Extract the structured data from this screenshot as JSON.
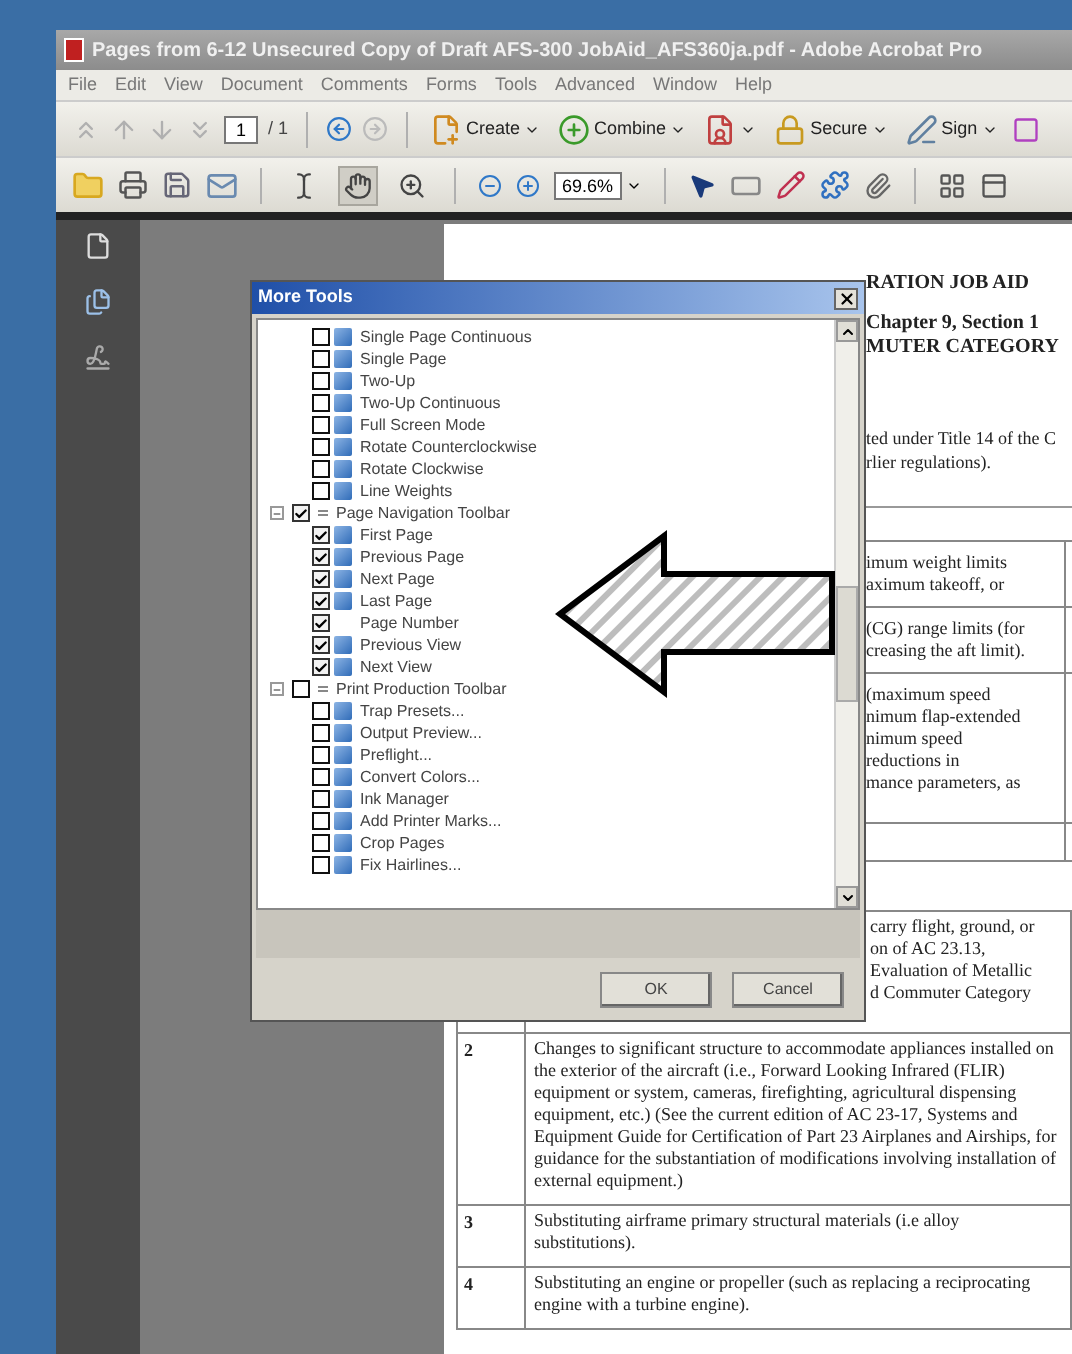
{
  "window": {
    "title": "Pages from 6-12 Unsecured Copy of Draft AFS-300 JobAid_AFS360ja.pdf - Adobe Acrobat Pro"
  },
  "menu": [
    "File",
    "Edit",
    "View",
    "Document",
    "Comments",
    "Forms",
    "Tools",
    "Advanced",
    "Window",
    "Help"
  ],
  "toolbar_1": {
    "page_number": "1",
    "page_count": "/ 1",
    "tasks": [
      {
        "label": "Create",
        "dropdown": true
      },
      {
        "label": "Combine",
        "dropdown": true
      },
      {
        "dropdown": true
      },
      {
        "label": "Secure",
        "dropdown": true
      },
      {
        "label": "Sign",
        "dropdown": true
      }
    ]
  },
  "toolbar_2": {
    "tools": [
      {
        "selected": false
      },
      {
        "selected": true
      },
      {
        "selected": false
      }
    ],
    "zoom": "69.6%"
  },
  "document": {
    "header": [
      "RATION JOB AID",
      "Chapter 9, Section 1",
      "MUTER CATEGORY"
    ],
    "intro": [
      "ted under Title 14 of the C",
      "rlier regulations)."
    ],
    "upper_rows": [
      [
        "imum weight limits",
        "aximum takeoff, or"
      ],
      [
        "(CG) range limits (for",
        "creasing the aft limit)."
      ],
      [
        "(maximum speed",
        "nimum flap-extended",
        "nimum speed",
        "reductions in",
        "mance parameters, as"
      ],
      []
    ],
    "table_rows": [
      {
        "number": "",
        "text": [
          "carry flight, ground, or",
          "on of AC 23.13,",
          "Evaluation of Metallic",
          "d Commuter Category"
        ]
      },
      {
        "number": "2",
        "text": [
          "Changes to significant structure to accommodate appliances installed on the exterior of the aircraft (i.e., Forward Looking Infrared (FLIR) equipment or system, cameras, firefighting, agricultural dispensing equipment, etc.) (See the current edition of AC 23-17, Systems and Equipment Guide for Certification of Part 23 Airplanes and Airships, for guidance for the substantiation of modifications involving installation of external equipment.)"
        ]
      },
      {
        "number": "3",
        "text": [
          "Substituting airframe primary structural materials (i.e alloy substitutions)."
        ]
      },
      {
        "number": "4",
        "text": [
          "Substituting an engine or propeller (such as replacing a reciprocating engine with a turbine engine)."
        ]
      }
    ]
  },
  "dialog": {
    "title": "More Tools",
    "groups": [
      {
        "children": [
          {
            "label": "Single Page Continuous",
            "checked": false,
            "icon": true
          },
          {
            "label": "Single Page",
            "checked": false,
            "icon": true
          },
          {
            "label": "Two-Up",
            "checked": false,
            "icon": true
          },
          {
            "label": "Two-Up Continuous",
            "checked": false,
            "icon": true
          },
          {
            "label": "Full Screen Mode",
            "checked": false,
            "icon": true
          },
          {
            "label": "Rotate Counterclockwise",
            "checked": false,
            "icon": true
          },
          {
            "label": "Rotate Clockwise",
            "checked": false,
            "icon": true
          },
          {
            "label": "Line Weights",
            "checked": false,
            "icon": true
          }
        ]
      },
      {
        "label": "Page Navigation Toolbar",
        "checked": true,
        "expanded": true,
        "children": [
          {
            "label": "First Page",
            "checked": true,
            "icon": true
          },
          {
            "label": "Previous Page",
            "checked": true,
            "icon": true
          },
          {
            "label": "Next Page",
            "checked": true,
            "icon": true
          },
          {
            "label": "Last Page",
            "checked": true,
            "icon": true
          },
          {
            "label": "Page Number",
            "checked": true,
            "icon": false
          },
          {
            "label": "Previous View",
            "checked": true,
            "icon": true
          },
          {
            "label": "Next View",
            "checked": true,
            "icon": true
          }
        ]
      },
      {
        "label": "Print Production Toolbar",
        "checked": false,
        "expanded": true,
        "children": [
          {
            "label": "Trap Presets...",
            "checked": false,
            "icon": true
          },
          {
            "label": "Output Preview...",
            "checked": false,
            "icon": true
          },
          {
            "label": "Preflight...",
            "checked": false,
            "icon": true
          },
          {
            "label": "Convert Colors...",
            "checked": false,
            "icon": true
          },
          {
            "label": "Ink Manager",
            "checked": false,
            "icon": true
          },
          {
            "label": "Add Printer Marks...",
            "checked": false,
            "icon": true
          },
          {
            "label": "Crop Pages",
            "checked": false,
            "icon": true
          },
          {
            "label": "Fix Hairlines...",
            "checked": false,
            "icon": true
          }
        ]
      }
    ],
    "buttons": [
      "OK",
      "Cancel"
    ]
  }
}
